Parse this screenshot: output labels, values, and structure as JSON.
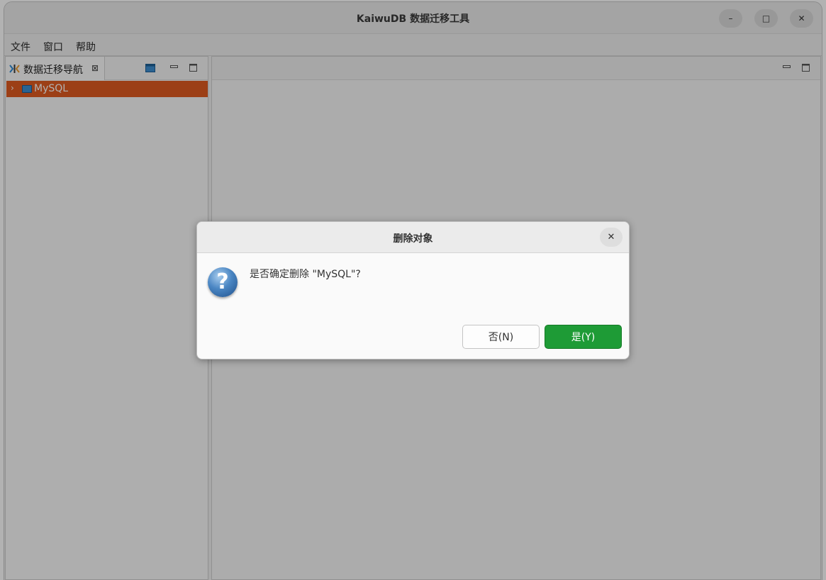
{
  "window": {
    "title": "KaiwuDB 数据迁移工具",
    "minimize_glyph": "–",
    "maximize_glyph": "□",
    "close_glyph": "✕"
  },
  "menubar": {
    "items": [
      "文件",
      "窗口",
      "帮助"
    ]
  },
  "navigator": {
    "tab_label": "数据迁移导航",
    "tab_close_glyph": "⊠",
    "tree": [
      {
        "label": "MySQL",
        "expanded": false,
        "selected": true,
        "icon": "database-icon"
      }
    ]
  },
  "dialog": {
    "title": "删除对象",
    "close_glyph": "✕",
    "icon": "question-icon",
    "message": "是否确定删除 \"MySQL\"?",
    "no_label": "否(N)",
    "yes_label": "是(Y)"
  },
  "colors": {
    "selection": "#e05b20",
    "primary_button": "#1e9b36",
    "database_icon": "#3d8fd1"
  }
}
